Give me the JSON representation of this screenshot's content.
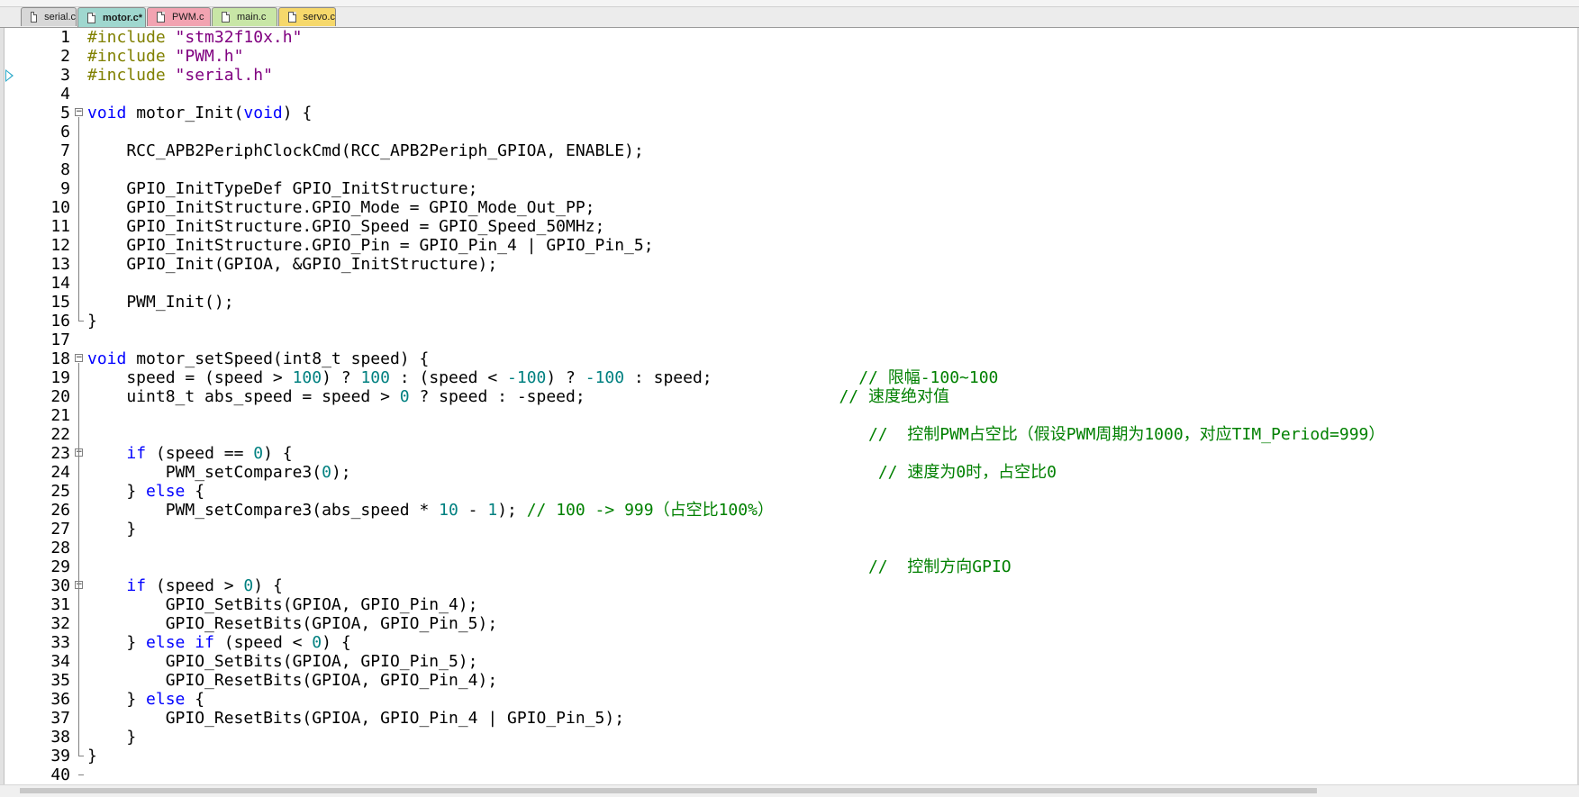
{
  "tabs": [
    {
      "label": "serial.c",
      "color": "#d7d7d7"
    },
    {
      "label": "motor.c*",
      "color": "#9fd7cf"
    },
    {
      "label": "PWM.c",
      "color": "#f2a3b1"
    },
    {
      "label": "main.c",
      "color": "#c8e6a6"
    },
    {
      "label": "servo.c",
      "color": "#f6d86b"
    }
  ],
  "active_tab": "motor.c*",
  "colors": {
    "keyword": "#0000ff",
    "preprocessor": "#808000",
    "string": "#800080",
    "number": "#008080",
    "comment": "#008000",
    "bookmark": "#2aa8c8"
  },
  "bookmark_line": 3,
  "lines": [
    {
      "n": "1",
      "tokens": [
        [
          "pp",
          "#include "
        ],
        [
          "str",
          "\"stm32f10x.h\""
        ]
      ]
    },
    {
      "n": "2",
      "tokens": [
        [
          "pp",
          "#include "
        ],
        [
          "str",
          "\"PWM.h\""
        ]
      ]
    },
    {
      "n": "3",
      "tokens": [
        [
          "pp",
          "#include "
        ],
        [
          "str",
          "\"serial.h\""
        ]
      ]
    },
    {
      "n": "4",
      "tokens": []
    },
    {
      "n": "5",
      "fold": "open",
      "tokens": [
        [
          "kw",
          "void"
        ],
        [
          "sym",
          " motor_Init("
        ],
        [
          "kw",
          "void"
        ],
        [
          "sym",
          ") {"
        ]
      ]
    },
    {
      "n": "6",
      "tokens": []
    },
    {
      "n": "7",
      "tokens": [
        [
          "sym",
          "    RCC_APB2PeriphClockCmd(RCC_APB2Periph_GPIOA, ENABLE);"
        ]
      ]
    },
    {
      "n": "8",
      "tokens": []
    },
    {
      "n": "9",
      "tokens": [
        [
          "sym",
          "    GPIO_InitTypeDef GPIO_InitStructure;"
        ]
      ]
    },
    {
      "n": "10",
      "tokens": [
        [
          "sym",
          "    GPIO_InitStructure.GPIO_Mode = GPIO_Mode_Out_PP;"
        ]
      ]
    },
    {
      "n": "11",
      "tokens": [
        [
          "sym",
          "    GPIO_InitStructure.GPIO_Speed = GPIO_Speed_50MHz;"
        ]
      ]
    },
    {
      "n": "12",
      "tokens": [
        [
          "sym",
          "    GPIO_InitStructure.GPIO_Pin = GPIO_Pin_4 | GPIO_Pin_5;"
        ]
      ]
    },
    {
      "n": "13",
      "tokens": [
        [
          "sym",
          "    GPIO_Init(GPIOA, &GPIO_InitStructure);"
        ]
      ]
    },
    {
      "n": "14",
      "tokens": []
    },
    {
      "n": "15",
      "tokens": [
        [
          "sym",
          "    PWM_Init();"
        ]
      ]
    },
    {
      "n": "16",
      "fold": "end",
      "tokens": [
        [
          "sym",
          "}"
        ]
      ]
    },
    {
      "n": "17",
      "tokens": []
    },
    {
      "n": "18",
      "fold": "open",
      "tokens": [
        [
          "kw",
          "void"
        ],
        [
          "sym",
          " motor_setSpeed(int8_t speed) {"
        ]
      ]
    },
    {
      "n": "19",
      "tokens": [
        [
          "sym",
          "    speed = (speed > "
        ],
        [
          "num",
          "100"
        ],
        [
          "sym",
          ") ? "
        ],
        [
          "num",
          "100"
        ],
        [
          "sym",
          " : (speed < "
        ],
        [
          "num",
          "-100"
        ],
        [
          "sym",
          ") ? "
        ],
        [
          "num",
          "-100"
        ],
        [
          "sym",
          " : speed;               "
        ],
        [
          "cmt",
          "// 限幅-100~100"
        ]
      ]
    },
    {
      "n": "20",
      "tokens": [
        [
          "sym",
          "    uint8_t abs_speed = speed > "
        ],
        [
          "num",
          "0"
        ],
        [
          "sym",
          " ? speed : -speed;                          "
        ],
        [
          "cmt",
          "// 速度绝对值"
        ]
      ]
    },
    {
      "n": "21",
      "tokens": []
    },
    {
      "n": "22",
      "tokens": [
        [
          "sym",
          "                                                                                "
        ],
        [
          "cmt",
          "//  控制PWM占空比（假设PWM周期为1000，对应TIM_Period=999）"
        ]
      ]
    },
    {
      "n": "23",
      "fold": "open",
      "tokens": [
        [
          "sym",
          "    "
        ],
        [
          "kw",
          "if"
        ],
        [
          "sym",
          " (speed == "
        ],
        [
          "num",
          "0"
        ],
        [
          "sym",
          ") {"
        ]
      ]
    },
    {
      "n": "24",
      "tokens": [
        [
          "sym",
          "        PWM_setCompare3("
        ],
        [
          "num",
          "0"
        ],
        [
          "sym",
          ");                                                      "
        ],
        [
          "cmt",
          "// 速度为0时，占空比0"
        ]
      ]
    },
    {
      "n": "25",
      "tokens": [
        [
          "sym",
          "    } "
        ],
        [
          "kw",
          "else"
        ],
        [
          "sym",
          " {"
        ]
      ]
    },
    {
      "n": "26",
      "tokens": [
        [
          "sym",
          "        PWM_setCompare3(abs_speed * "
        ],
        [
          "num",
          "10"
        ],
        [
          "sym",
          " - "
        ],
        [
          "num",
          "1"
        ],
        [
          "sym",
          "); "
        ],
        [
          "cmt",
          "// 100 -> 999（占空比100%）"
        ]
      ]
    },
    {
      "n": "27",
      "tokens": [
        [
          "sym",
          "    }"
        ]
      ]
    },
    {
      "n": "28",
      "tokens": []
    },
    {
      "n": "29",
      "tokens": [
        [
          "sym",
          "                                                                                "
        ],
        [
          "cmt",
          "//  控制方向GPIO"
        ]
      ]
    },
    {
      "n": "30",
      "fold": "open",
      "tokens": [
        [
          "sym",
          "    "
        ],
        [
          "kw",
          "if"
        ],
        [
          "sym",
          " (speed > "
        ],
        [
          "num",
          "0"
        ],
        [
          "sym",
          ") {"
        ]
      ]
    },
    {
      "n": "31",
      "tokens": [
        [
          "sym",
          "        GPIO_SetBits(GPIOA, GPIO_Pin_4);"
        ]
      ]
    },
    {
      "n": "32",
      "tokens": [
        [
          "sym",
          "        GPIO_ResetBits(GPIOA, GPIO_Pin_5);"
        ]
      ]
    },
    {
      "n": "33",
      "tokens": [
        [
          "sym",
          "    } "
        ],
        [
          "kw",
          "else"
        ],
        [
          "sym",
          " "
        ],
        [
          "kw",
          "if"
        ],
        [
          "sym",
          " (speed < "
        ],
        [
          "num",
          "0"
        ],
        [
          "sym",
          ") {"
        ]
      ]
    },
    {
      "n": "34",
      "tokens": [
        [
          "sym",
          "        GPIO_SetBits(GPIOA, GPIO_Pin_5);"
        ]
      ]
    },
    {
      "n": "35",
      "tokens": [
        [
          "sym",
          "        GPIO_ResetBits(GPIOA, GPIO_Pin_4);"
        ]
      ]
    },
    {
      "n": "36",
      "tokens": [
        [
          "sym",
          "    } "
        ],
        [
          "kw",
          "else"
        ],
        [
          "sym",
          " {"
        ]
      ]
    },
    {
      "n": "37",
      "tokens": [
        [
          "sym",
          "        GPIO_ResetBits(GPIOA, GPIO_Pin_4 | GPIO_Pin_5);"
        ]
      ]
    },
    {
      "n": "38",
      "tokens": [
        [
          "sym",
          "    }"
        ]
      ]
    },
    {
      "n": "39",
      "fold": "end",
      "tokens": [
        [
          "sym",
          "}"
        ]
      ]
    },
    {
      "n": "40",
      "fold": "tail",
      "tokens": []
    }
  ]
}
